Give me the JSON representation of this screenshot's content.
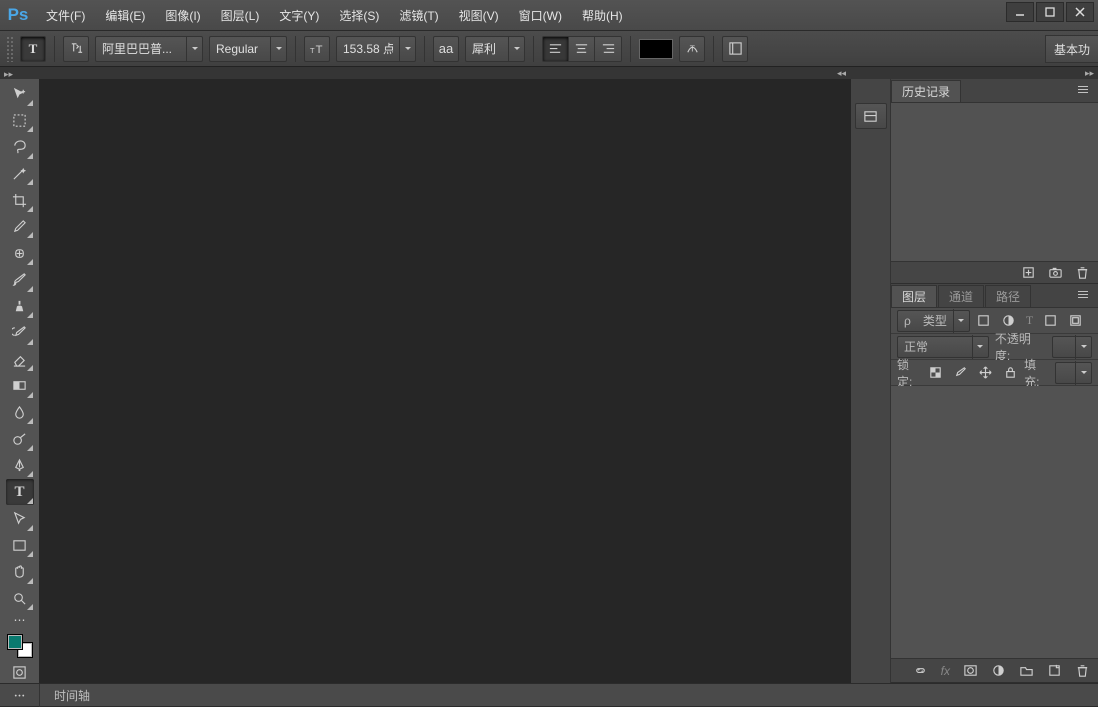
{
  "app": {
    "logo": "Ps"
  },
  "menu": {
    "items": [
      "文件(F)",
      "编辑(E)",
      "图像(I)",
      "图层(L)",
      "文字(Y)",
      "选择(S)",
      "滤镜(T)",
      "视图(V)",
      "窗口(W)",
      "帮助(H)"
    ]
  },
  "options": {
    "font_family": "阿里巴巴普...",
    "font_style": "Regular",
    "font_size": "153.58 点",
    "aa_label": "aa",
    "aa_mode": "犀利",
    "workspace_btn": "基本功"
  },
  "tools_palette": {
    "fg_color": "#0a7a6f",
    "bg_color": "#ffffff"
  },
  "panels": {
    "history": {
      "tab": "历史记录"
    },
    "layers": {
      "tabs": [
        "图层",
        "通道",
        "路径"
      ],
      "kind_prefix": "ρ",
      "kind": "类型",
      "blend_mode": "正常",
      "opacity_label": "不透明度:",
      "lock_label": "锁定:",
      "fill_label": "填充:"
    }
  },
  "bottom": {
    "timeline": "时间轴"
  }
}
